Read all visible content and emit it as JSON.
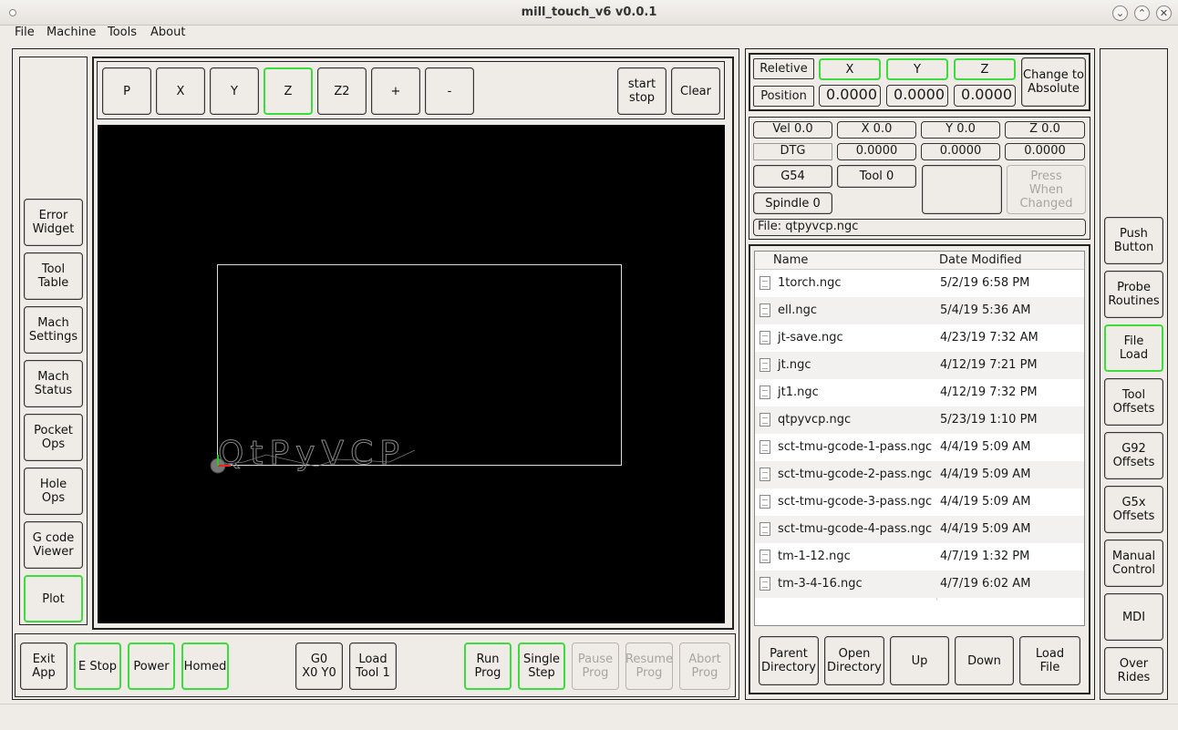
{
  "window": {
    "title": "mill_touch_v6 v0.0.1"
  },
  "menu": [
    "File",
    "Machine",
    "Tools",
    "About"
  ],
  "jog": {
    "buttons": [
      "P",
      "X",
      "Y",
      "Z",
      "Z2",
      "+",
      "-"
    ],
    "start_stop": "start\nstop",
    "clear": "Clear"
  },
  "plot_text": "QtPyVCP",
  "left_nav": [
    "Error\nWidget",
    "Tool\nTable",
    "Mach\nSettings",
    "Mach\nStatus",
    "Pocket\nOps",
    "Hole\nOps",
    "G code\nViewer",
    "Plot"
  ],
  "bottom": {
    "exit": "Exit\nApp",
    "estop": "E Stop",
    "power": "Power",
    "homed": "Homed",
    "g0": "G0\nX0 Y0",
    "load_tool": "Load\nTool 1",
    "run": "Run\nProg",
    "single": "Single\nStep",
    "pause": "Pause\nProg",
    "resume": "Resume\nProg",
    "abort": "Abort\nProg"
  },
  "dro": {
    "relative_label": "Reletive",
    "position_label": "Position",
    "axes": [
      "X",
      "Y",
      "Z"
    ],
    "values": [
      "0.0000",
      "0.0000",
      "0.0000"
    ],
    "change_btn": "Change to\nAbsolute"
  },
  "status": {
    "vel": "Vel 0.0",
    "x": "X 0.0",
    "y": "Y 0.0",
    "z": "Z 0.0",
    "dtg": "DTG",
    "dtg_vals": [
      "0.0000",
      "0.0000",
      "0.0000"
    ],
    "g54": "G54",
    "tool": "Tool 0",
    "press": "Press\nWhen\nChanged",
    "spindle": "Spindle 0",
    "file": "File: qtpyvcp.ngc"
  },
  "files": {
    "headers": [
      "Name",
      "Date Modified"
    ],
    "rows": [
      [
        "1torch.ngc",
        "5/2/19 6:58 PM"
      ],
      [
        "ell.ngc",
        "5/4/19 5:36 AM"
      ],
      [
        "jt-save.ngc",
        "4/23/19 7:32 AM"
      ],
      [
        "jt.ngc",
        "4/12/19 7:21 PM"
      ],
      [
        "jt1.ngc",
        "4/12/19 7:32 PM"
      ],
      [
        "qtpyvcp.ngc",
        "5/23/19 1:10 PM"
      ],
      [
        "sct-tmu-gcode-1-pass.ngc",
        "4/4/19 5:09 AM"
      ],
      [
        "sct-tmu-gcode-2-pass.ngc",
        "4/4/19 5:09 AM"
      ],
      [
        "sct-tmu-gcode-3-pass.ngc",
        "4/4/19 5:09 AM"
      ],
      [
        "sct-tmu-gcode-4-pass.ngc",
        "4/4/19 5:09 AM"
      ],
      [
        "tm-1-12.ngc",
        "4/7/19 1:32 PM"
      ],
      [
        "tm-3-4-16.ngc",
        "4/7/19 6:02 AM"
      ]
    ]
  },
  "file_nav": [
    "Parent\nDirectory",
    "Open\nDirectory",
    "Up",
    "Down",
    "Load\nFile"
  ],
  "right_nav": [
    "Push\nButton",
    "Probe\nRoutines",
    "File\nLoad",
    "Tool\nOffsets",
    "G92\nOffsets",
    "G5x\nOffsets",
    "Manual\nControl",
    "MDI",
    "Over\nRides"
  ]
}
